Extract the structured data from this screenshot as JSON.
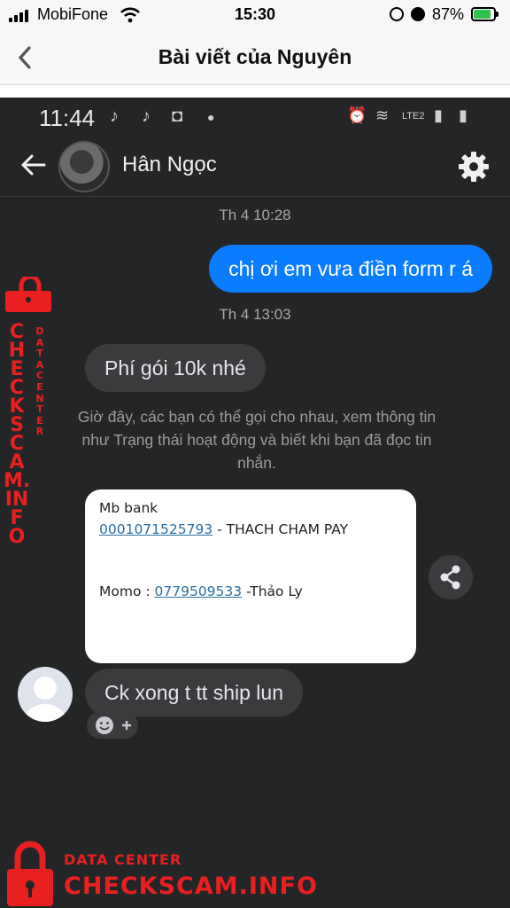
{
  "ios_status": {
    "carrier": "MobiFone",
    "time": "15:30",
    "battery": "87%",
    "battery_level": 0.87
  },
  "ios_nav": {
    "title": "Bài viết của Nguyên"
  },
  "android_status": {
    "time": "11:44",
    "network": "LTE2"
  },
  "chat": {
    "contact_name": "Hân Ngọc",
    "messages": [
      {
        "type": "timestamp",
        "text": "Th 4 10:28"
      },
      {
        "type": "outgoing",
        "text": "chị ơi em vưa điền form r á"
      },
      {
        "type": "timestamp",
        "text": "Th 4 13:03"
      },
      {
        "type": "incoming",
        "text": "Phí gói 10k nhé"
      },
      {
        "type": "system",
        "text": "Giờ đây, các bạn có thể gọi cho nhau, xem thông tin như Trạng thái hoạt động và biết khi bạn đã đọc tin nhắn."
      },
      {
        "type": "incoming",
        "text": "Ck xong t tt ship lun"
      }
    ],
    "card": {
      "bank_label": "Mb bank",
      "account_number": "0001071525793",
      "account_name": " - THACH CHAM PAY",
      "momo_label": "Momo : ",
      "momo_number": "0779509533",
      "momo_name": " -Thảo Ly"
    }
  },
  "watermark": {
    "label": "DATA CENTER",
    "brand": "CHECKSCAM.INFO"
  },
  "colors": {
    "outgoing_bubble": "#0a7cff",
    "incoming_bubble": "#3a3b3c",
    "chat_background": "#242526",
    "watermark": "#e8201f"
  },
  "icons": [
    "signal-icon",
    "wifi-icon",
    "rotation-lock-icon",
    "alarm-icon",
    "battery-icon",
    "back-chevron-icon",
    "back-arrow-icon",
    "settings-gear-icon",
    "share-icon",
    "add-reaction-icon",
    "lock-icon"
  ]
}
